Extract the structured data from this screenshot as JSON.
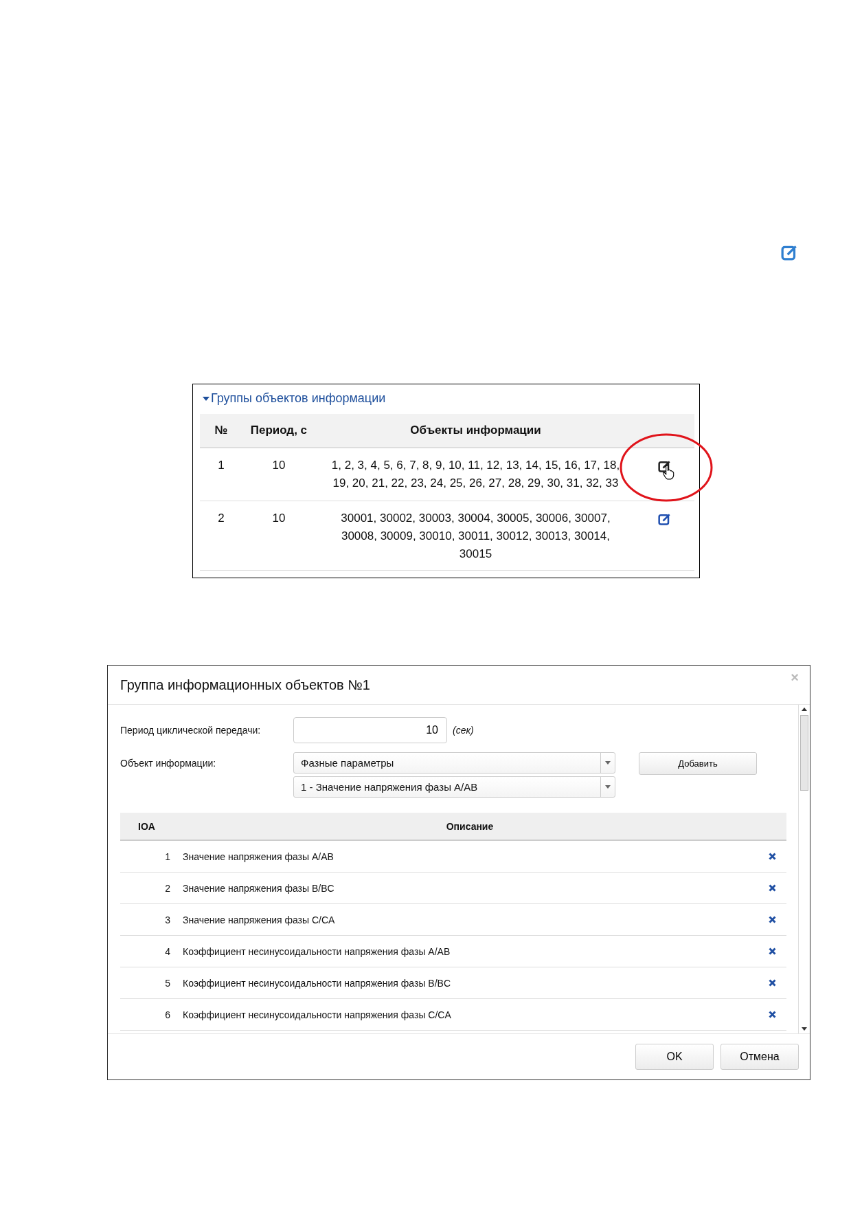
{
  "page_edit_icon": {
    "hovered": false
  },
  "groups_panel": {
    "section": "Группы объектов информации",
    "expanded": true,
    "columns": [
      "№",
      "Период, с",
      "Объекты информации"
    ],
    "rows": [
      {
        "number": "1",
        "period": "10",
        "objects": "1, 2, 3, 4, 5, 6, 7, 8, 9, 10, 11, 12, 13, 14, 15, 16, 17, 18, 19, 20, 21, 22, 23, 24, 25, 26, 27, 28, 29, 30, 31, 32, 33",
        "hovered": true
      },
      {
        "number": "2",
        "period": "10",
        "objects": "30001, 30002, 30003, 30004, 30005, 30006, 30007, 30008, 30009, 30010, 30011, 30012, 30013, 30014, 30015",
        "hovered": false
      }
    ]
  },
  "dialog": {
    "title": "Группа информационных объектов №1",
    "close": "×",
    "period_label": "Период циклической передачи:",
    "period_value": "10",
    "period_unit": "(сек)",
    "object_label": "Объект информации:",
    "category_select": "Фазные параметры",
    "object_select": "1 - Значение напряжения фазы A/AB",
    "add_button": "Добавить",
    "columns": [
      "IOA",
      "Описание"
    ],
    "rows": [
      {
        "ioa": "1",
        "description": "Значение напряжения фазы A/AB"
      },
      {
        "ioa": "2",
        "description": "Значение напряжения фазы B/BC"
      },
      {
        "ioa": "3",
        "description": "Значение напряжения фазы C/CA"
      },
      {
        "ioa": "4",
        "description": "Коэффициент несинусоидальности напряжения фазы A/AB"
      },
      {
        "ioa": "5",
        "description": "Коэффициент несинусоидальности напряжения фазы B/BC"
      },
      {
        "ioa": "6",
        "description": "Коэффициент несинусоидальности напряжения фазы C/CA"
      }
    ],
    "buttons": [
      "OK",
      "Отмена"
    ]
  }
}
